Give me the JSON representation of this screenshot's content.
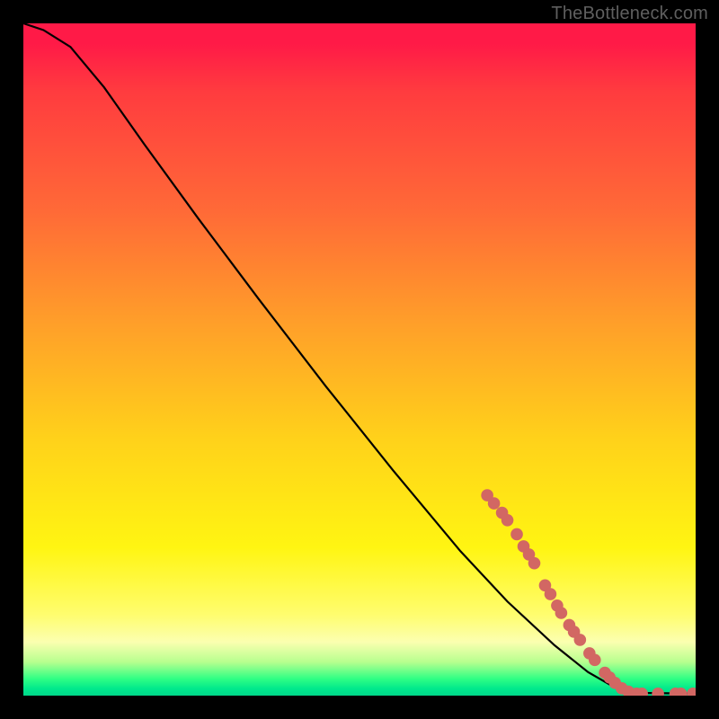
{
  "watermark": "TheBottleneck.com",
  "chart_data": {
    "type": "line",
    "title": "",
    "xlabel": "",
    "ylabel": "",
    "xlim": [
      0,
      1
    ],
    "ylim": [
      0,
      1
    ],
    "curve": [
      {
        "x": 0.0,
        "y": 1.0
      },
      {
        "x": 0.03,
        "y": 0.99
      },
      {
        "x": 0.07,
        "y": 0.965
      },
      {
        "x": 0.12,
        "y": 0.905
      },
      {
        "x": 0.18,
        "y": 0.82
      },
      {
        "x": 0.26,
        "y": 0.71
      },
      {
        "x": 0.35,
        "y": 0.59
      },
      {
        "x": 0.45,
        "y": 0.46
      },
      {
        "x": 0.55,
        "y": 0.335
      },
      {
        "x": 0.65,
        "y": 0.215
      },
      {
        "x": 0.72,
        "y": 0.14
      },
      {
        "x": 0.79,
        "y": 0.075
      },
      {
        "x": 0.84,
        "y": 0.035
      },
      {
        "x": 0.88,
        "y": 0.012
      },
      {
        "x": 0.92,
        "y": 0.004
      },
      {
        "x": 1.0,
        "y": 0.003
      }
    ],
    "series": [
      {
        "name": "markers",
        "color": "#d26763",
        "points": [
          {
            "x": 0.69,
            "y": 0.298
          },
          {
            "x": 0.7,
            "y": 0.286
          },
          {
            "x": 0.712,
            "y": 0.272
          },
          {
            "x": 0.72,
            "y": 0.261
          },
          {
            "x": 0.734,
            "y": 0.24
          },
          {
            "x": 0.744,
            "y": 0.222
          },
          {
            "x": 0.752,
            "y": 0.21
          },
          {
            "x": 0.76,
            "y": 0.197
          },
          {
            "x": 0.776,
            "y": 0.164
          },
          {
            "x": 0.784,
            "y": 0.151
          },
          {
            "x": 0.794,
            "y": 0.134
          },
          {
            "x": 0.8,
            "y": 0.123
          },
          {
            "x": 0.812,
            "y": 0.105
          },
          {
            "x": 0.819,
            "y": 0.095
          },
          {
            "x": 0.828,
            "y": 0.083
          },
          {
            "x": 0.842,
            "y": 0.063
          },
          {
            "x": 0.85,
            "y": 0.053
          },
          {
            "x": 0.865,
            "y": 0.034
          },
          {
            "x": 0.872,
            "y": 0.027
          },
          {
            "x": 0.88,
            "y": 0.019
          },
          {
            "x": 0.89,
            "y": 0.011
          },
          {
            "x": 0.9,
            "y": 0.006
          },
          {
            "x": 0.912,
            "y": 0.003
          },
          {
            "x": 0.92,
            "y": 0.003
          },
          {
            "x": 0.944,
            "y": 0.003
          },
          {
            "x": 0.97,
            "y": 0.003
          },
          {
            "x": 0.978,
            "y": 0.003
          },
          {
            "x": 0.996,
            "y": 0.003
          }
        ]
      }
    ],
    "background_gradient": {
      "stops": [
        {
          "pos": 0.0,
          "color": "#ff1a47"
        },
        {
          "pos": 0.45,
          "color": "#ffa029"
        },
        {
          "pos": 0.78,
          "color": "#fff512"
        },
        {
          "pos": 0.97,
          "color": "#2fff84"
        },
        {
          "pos": 1.0,
          "color": "#00d789"
        }
      ]
    }
  },
  "colors": {
    "frame_bg": "#000000",
    "curve": "#000000",
    "marker": "#d26763",
    "watermark": "#5f5f5f"
  }
}
